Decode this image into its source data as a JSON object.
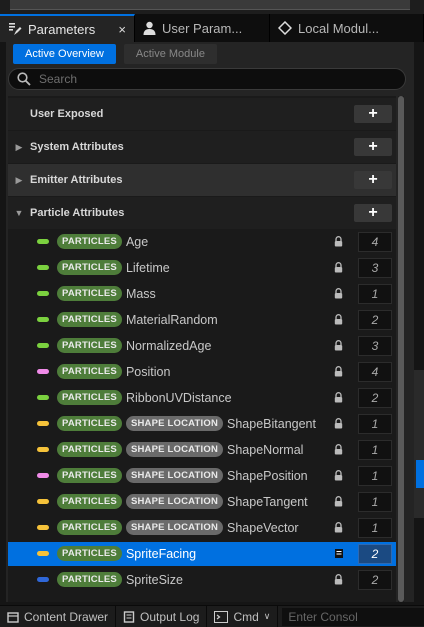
{
  "tabs": [
    {
      "label": "Parameters",
      "active": true,
      "close": "×"
    },
    {
      "label": "User Param..."
    },
    {
      "label": "Local Modul..."
    }
  ],
  "toggles": {
    "active_overview": "Active Overview",
    "active_module": "Active Module"
  },
  "search": {
    "placeholder": "Search"
  },
  "categories": [
    {
      "label": "User Exposed",
      "expanded": null
    },
    {
      "label": "System Attributes",
      "expanded": false
    },
    {
      "label": "Emitter Attributes",
      "expanded": false
    },
    {
      "label": "Particle Attributes",
      "expanded": true
    }
  ],
  "add_glyph": "+",
  "badges": {
    "particles": "PARTICLES",
    "shape": "SHAPE LOCATION"
  },
  "rows": [
    {
      "name": "Age",
      "pill": "#7bd13f",
      "shape": false,
      "count": "4",
      "selected": false
    },
    {
      "name": "Lifetime",
      "pill": "#7bd13f",
      "shape": false,
      "count": "3",
      "selected": false
    },
    {
      "name": "Mass",
      "pill": "#7bd13f",
      "shape": false,
      "count": "1",
      "selected": false
    },
    {
      "name": "MaterialRandom",
      "pill": "#7bd13f",
      "shape": false,
      "count": "2",
      "selected": false
    },
    {
      "name": "NormalizedAge",
      "pill": "#7bd13f",
      "shape": false,
      "count": "3",
      "selected": false
    },
    {
      "name": "Position",
      "pill": "#f08be8",
      "shape": false,
      "count": "4",
      "selected": false
    },
    {
      "name": "RibbonUVDistance",
      "pill": "#7bd13f",
      "shape": false,
      "count": "2",
      "selected": false
    },
    {
      "name": "ShapeBitangent",
      "pill": "#f5c23a",
      "shape": true,
      "count": "1",
      "selected": false
    },
    {
      "name": "ShapeNormal",
      "pill": "#f5c23a",
      "shape": true,
      "count": "1",
      "selected": false
    },
    {
      "name": "ShapePosition",
      "pill": "#f08be8",
      "shape": true,
      "count": "1",
      "selected": false
    },
    {
      "name": "ShapeTangent",
      "pill": "#f5c23a",
      "shape": true,
      "count": "1",
      "selected": false
    },
    {
      "name": "ShapeVector",
      "pill": "#f5c23a",
      "shape": true,
      "count": "1",
      "selected": false
    },
    {
      "name": "SpriteFacing",
      "pill": "#f5c23a",
      "shape": false,
      "count": "2",
      "selected": true
    },
    {
      "name": "SpriteSize",
      "pill": "#2f67d8",
      "shape": false,
      "count": "2",
      "selected": false
    }
  ],
  "bottom": {
    "content_drawer": "Content Drawer",
    "output_log": "Output Log",
    "cmd": "Cmd",
    "console_placeholder": "Enter Consol"
  },
  "colors": {
    "accent": "#0070e0",
    "particles_badge": "#4e7d3a",
    "shape_badge": "#6a6a6a"
  }
}
